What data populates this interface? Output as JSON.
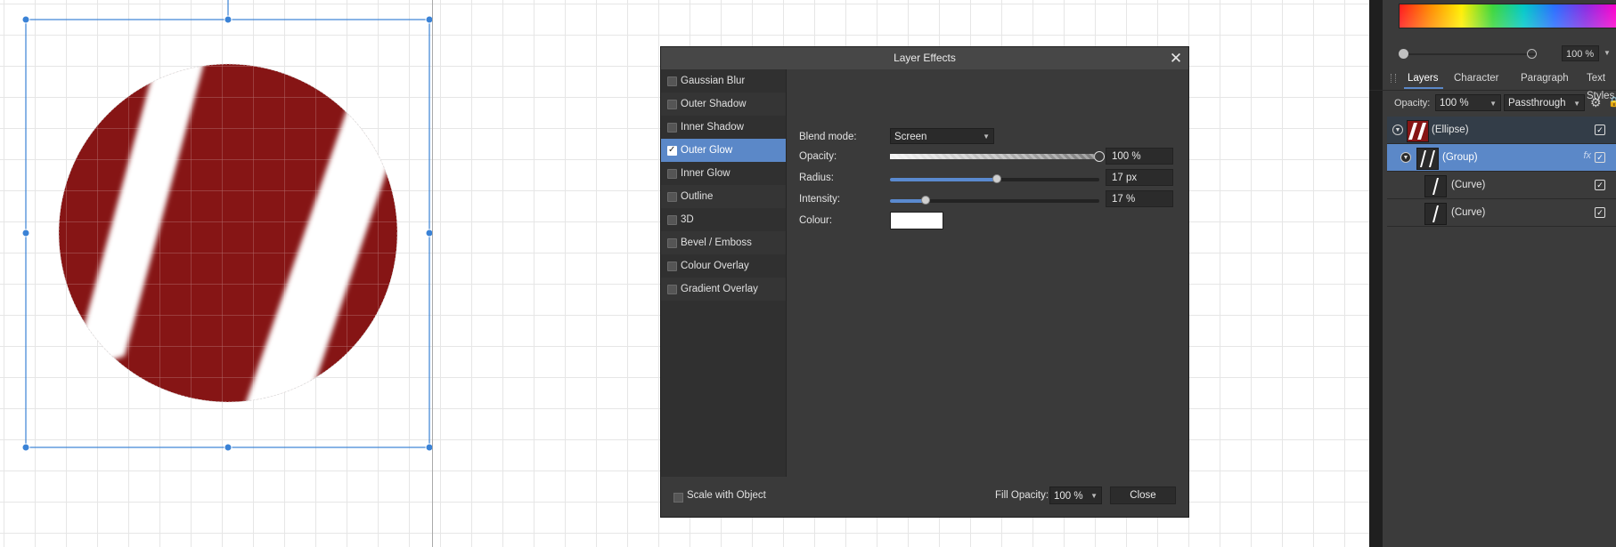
{
  "dialog": {
    "title": "Layer Effects",
    "effects": [
      {
        "label": "Gaussian Blur",
        "checked": false
      },
      {
        "label": "Outer Shadow",
        "checked": false
      },
      {
        "label": "Inner Shadow",
        "checked": false
      },
      {
        "label": "Outer Glow",
        "checked": true,
        "selected": true
      },
      {
        "label": "Inner Glow",
        "checked": false
      },
      {
        "label": "Outline",
        "checked": false
      },
      {
        "label": "3D",
        "checked": false
      },
      {
        "label": "Bevel / Emboss",
        "checked": false
      },
      {
        "label": "Colour Overlay",
        "checked": false
      },
      {
        "label": "Gradient Overlay",
        "checked": false
      }
    ],
    "blend_mode": {
      "label": "Blend mode:",
      "value": "Screen"
    },
    "opacity": {
      "label": "Opacity:",
      "value": "100 %",
      "level": 1.0
    },
    "radius": {
      "label": "Radius:",
      "value": "17 px",
      "level": 0.51
    },
    "intensity": {
      "label": "Intensity:",
      "value": "17 %",
      "level": 0.17
    },
    "colour": {
      "label": "Colour:",
      "value": "#ffffff"
    },
    "scale_with_object": "Scale with Object",
    "fill_opacity": {
      "label": "Fill Opacity:",
      "value": "100 %"
    },
    "close_button": "Close"
  },
  "panel": {
    "top_opacity_value": "100 %",
    "tabs": [
      "Layers",
      "Character",
      "Paragraph",
      "Text Styles"
    ],
    "opacity_label": "Opacity:",
    "opacity_value": "100 %",
    "blend_value": "Passthrough",
    "layers": [
      {
        "name": "(Ellipse)",
        "visible": true
      },
      {
        "name": "(Group)",
        "visible": true,
        "selected": true
      },
      {
        "name": "(Curve)",
        "visible": true
      },
      {
        "name": "(Curve)",
        "visible": true
      }
    ]
  },
  "colors": {
    "ellipse_fill": "#861515",
    "selection_blue": "#3a82d6",
    "accent": "#5b88c8"
  }
}
